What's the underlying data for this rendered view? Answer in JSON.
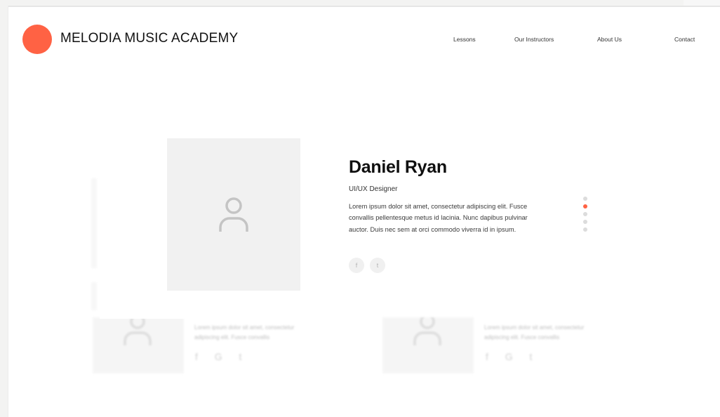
{
  "brand": {
    "name": "MELODIA MUSIC ACADEMY",
    "accent_color": "#ff6244"
  },
  "nav": {
    "items": [
      {
        "label": "Lessons"
      },
      {
        "label": "Our Instructors"
      },
      {
        "label": "About Us"
      },
      {
        "label": "Contact"
      }
    ]
  },
  "featured": {
    "name": "Daniel Ryan",
    "role": "UI/UX Designer",
    "bio": "Lorem ipsum dolor sit amet, consectetur adipiscing elit. Fusce convallis pellentesque metus id lacinia. Nunc dapibus pulvinar auctor. Duis nec sem at orci commodo viverra id in ipsum.",
    "photo_icon": "user-icon",
    "social": [
      {
        "icon": "facebook-icon",
        "glyph": "f"
      },
      {
        "icon": "twitter-icon",
        "glyph": "t"
      }
    ]
  },
  "carousel": {
    "count": 5,
    "active_index": 1
  },
  "background_cards": [
    {
      "text": "Lorem ipsum dolor sit amet, consectetur adipiscing elit. Fusce convallis",
      "social": "f G t"
    },
    {
      "text": "Lorem ipsum dolor sit amet, consectetur adipiscing elit. Fusce convallis",
      "social": "f G t"
    }
  ]
}
